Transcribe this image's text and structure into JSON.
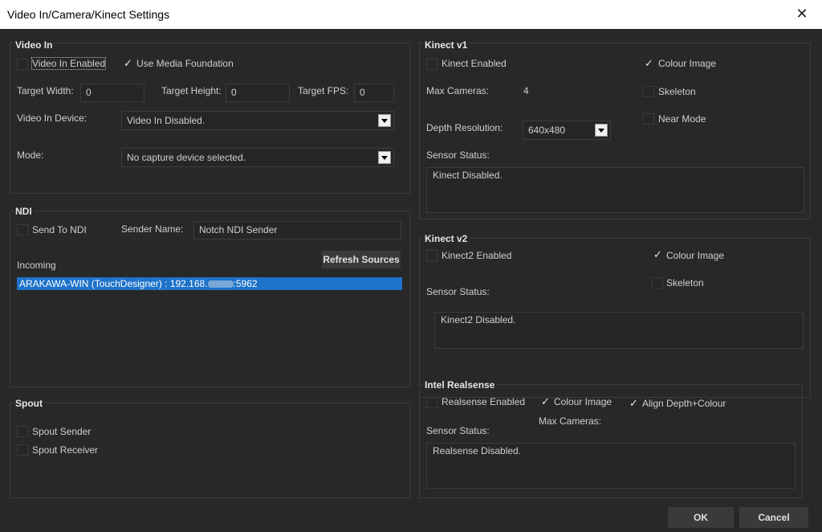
{
  "window": {
    "title": "Video In/Camera/Kinect Settings",
    "close": "✕"
  },
  "video_in": {
    "title": "Video In",
    "video_in_enabled": "Video In Enabled",
    "use_media_foundation": "Use Media Foundation",
    "target_width_label": "Target Width:",
    "target_width": "0",
    "target_height_label": "Target Height:",
    "target_height": "0",
    "target_fps_label": "Target FPS:",
    "target_fps": "0",
    "device_label": "Video In Device:",
    "device_value": "Video In Disabled.",
    "mode_label": "Mode:",
    "mode_value": "No capture device selected."
  },
  "ndi": {
    "title": "NDI",
    "send_to_ndi": "Send To NDI",
    "sender_name_label": "Sender Name:",
    "sender_name": "Notch NDI Sender",
    "incoming_label": "Incoming",
    "refresh_button": "Refresh Sources",
    "sources": [
      {
        "left": "ARAKAWA-WIN (TouchDesigner) : 192.168.",
        "right": ":5962"
      }
    ]
  },
  "spout": {
    "title": "Spout",
    "sender": "Spout Sender",
    "receiver": "Spout Receiver"
  },
  "kinect_v1": {
    "title": "Kinect v1",
    "enabled": "Kinect Enabled",
    "colour_image": "Colour Image",
    "skeleton": "Skeleton",
    "near_mode": "Near Mode",
    "max_cameras_label": "Max Cameras:",
    "max_cameras": "4",
    "depth_resolution_label": "Depth Resolution:",
    "depth_resolution": "640x480",
    "sensor_status_label": "Sensor Status:",
    "sensor_status": "Kinect Disabled."
  },
  "kinect_v2": {
    "title": "Kinect v2",
    "enabled": "Kinect2 Enabled",
    "colour_image": "Colour Image",
    "skeleton": "Skeleton",
    "sensor_status_label": "Sensor Status:",
    "sensor_status": "Kinect2 Disabled."
  },
  "realsense": {
    "title": "Intel Realsense",
    "enabled": "Realsense Enabled",
    "colour_image": "Colour Image",
    "align": "Align Depth+Colour",
    "max_cameras_label": "Max Cameras:",
    "sensor_status_label": "Sensor Status:",
    "sensor_status": "Realsense Disabled."
  },
  "buttons": {
    "ok": "OK",
    "cancel": "Cancel"
  },
  "checks": {
    "tick": "✓"
  }
}
